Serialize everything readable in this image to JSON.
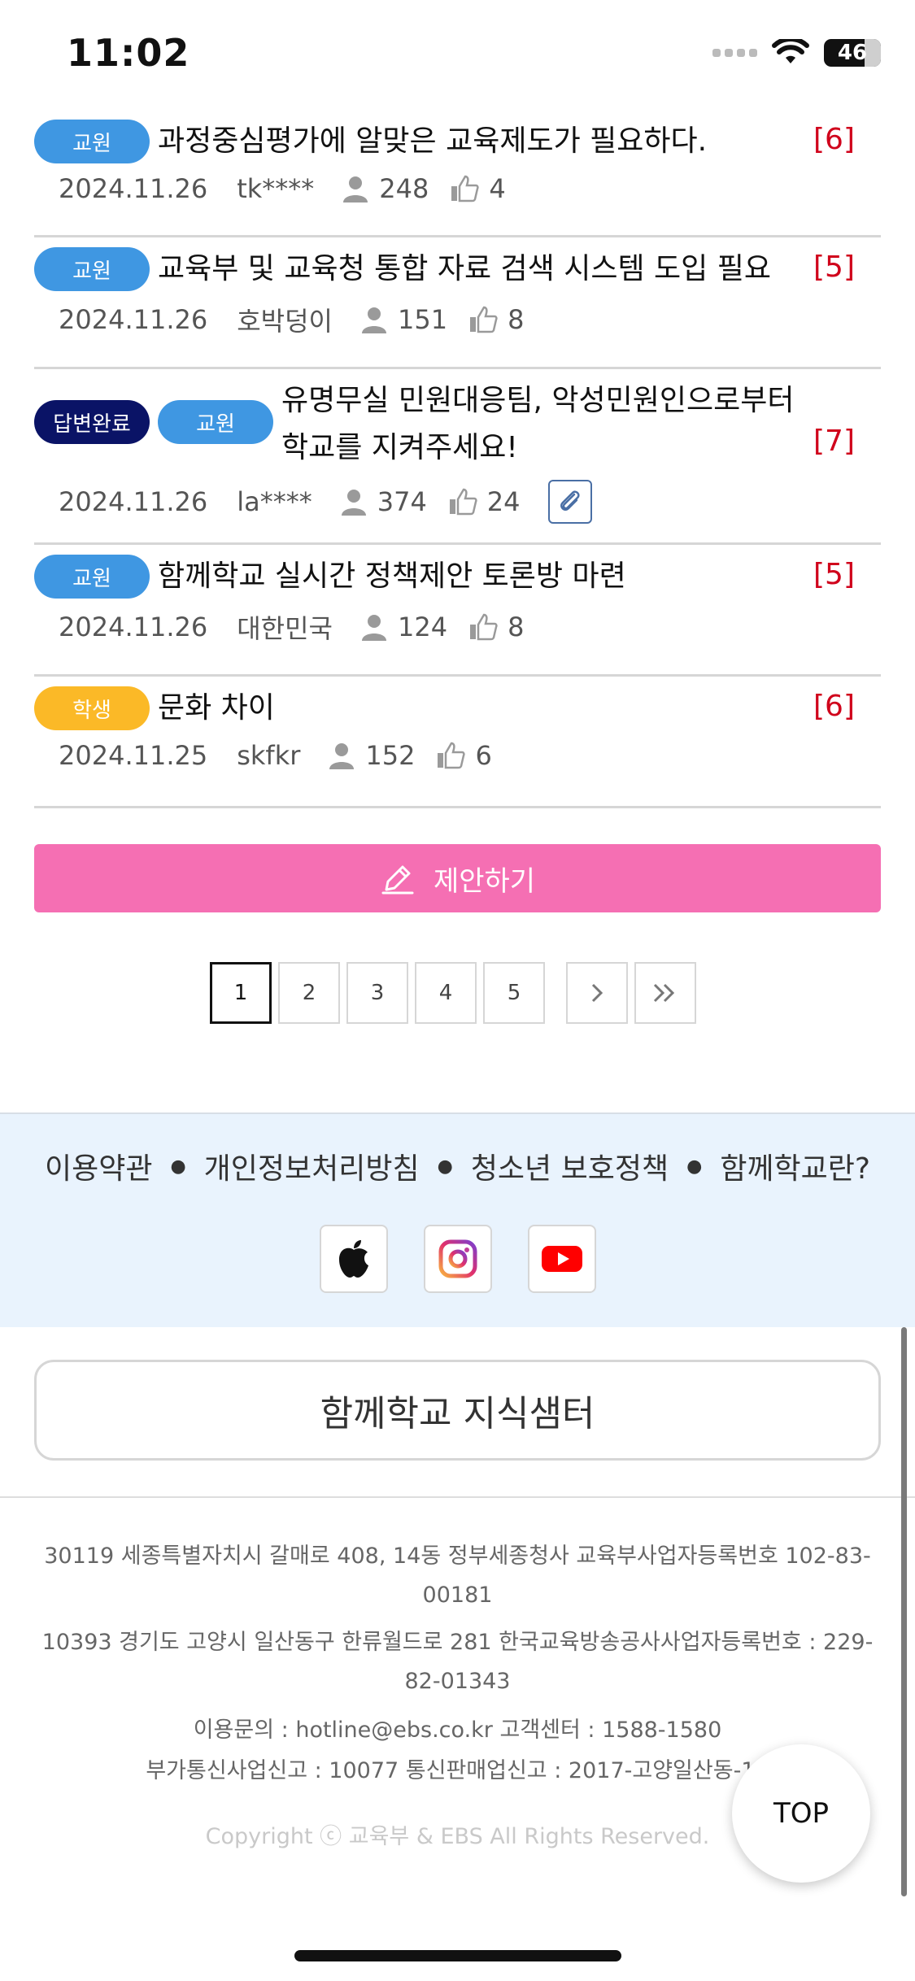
{
  "status": {
    "time": "11:02",
    "battery": "46"
  },
  "posts": [
    {
      "badges": [
        {
          "label": "교원",
          "type": "teacher"
        }
      ],
      "title": "과정중심평가에 알맞은 교육제도가 필요하다.",
      "count": "[6]",
      "date": "2024.11.26",
      "author": "tk****",
      "views": "248",
      "likes": "4"
    },
    {
      "badges": [
        {
          "label": "교원",
          "type": "teacher"
        }
      ],
      "title": "교육부 및 교육청 통합 자료 검색 시스템 도입 필요",
      "count": "[5]",
      "date": "2024.11.26",
      "author": "호박덩이",
      "views": "151",
      "likes": "8"
    },
    {
      "badges": [
        {
          "label": "답변완료",
          "type": "done"
        },
        {
          "label": "교원",
          "type": "teacher"
        }
      ],
      "title": "유명무실 민원대응팀, 악성민원인으로부터 학교를 지켜주세요!",
      "count": "[7]",
      "date": "2024.11.26",
      "author": "la****",
      "views": "374",
      "likes": "24",
      "attachment": true
    },
    {
      "badges": [
        {
          "label": "교원",
          "type": "teacher"
        }
      ],
      "title": "함께학교 실시간 정책제안 토론방 마련",
      "count": "[5]",
      "date": "2024.11.26",
      "author": "대한민국",
      "views": "124",
      "likes": "8"
    },
    {
      "badges": [
        {
          "label": "학생",
          "type": "student"
        }
      ],
      "title": "문화 차이",
      "count": "[6]",
      "date": "2024.11.25",
      "author": "skfkr",
      "views": "152",
      "likes": "6"
    }
  ],
  "propose_label": "제안하기",
  "pagination": [
    "1",
    "2",
    "3",
    "4",
    "5"
  ],
  "footer": {
    "links": [
      "이용약관",
      "개인정보처리방침",
      "청소년 보호정책",
      "함께학교란?"
    ],
    "knowledge_center": "함께학교 지식샘터",
    "address1": "30119 세종특별자치시 갈매로 408, 14동 정부세종청사 교육부사업자등록번호 102-83-00181",
    "address2": "10393 경기도 고양시 일산동구 한류월드로 281 한국교육방송공사사업자등록번호 : 229-82-01343",
    "contact": "이용문의 : hotline@ebs.co.kr   고객센터 : 1588-1580",
    "license": "부가통신사업신고 : 10077   통신판매업신고 : 2017-고양일산동-14",
    "copyright": "Copyright ⓒ 교육부 & EBS All Rights Reserved."
  },
  "top_label": "TOP",
  "colors": {
    "teacher": "#3f97e2",
    "student": "#fbb927",
    "done": "#0a1366",
    "propose": "#f56fb3",
    "count": "#d0021b"
  }
}
